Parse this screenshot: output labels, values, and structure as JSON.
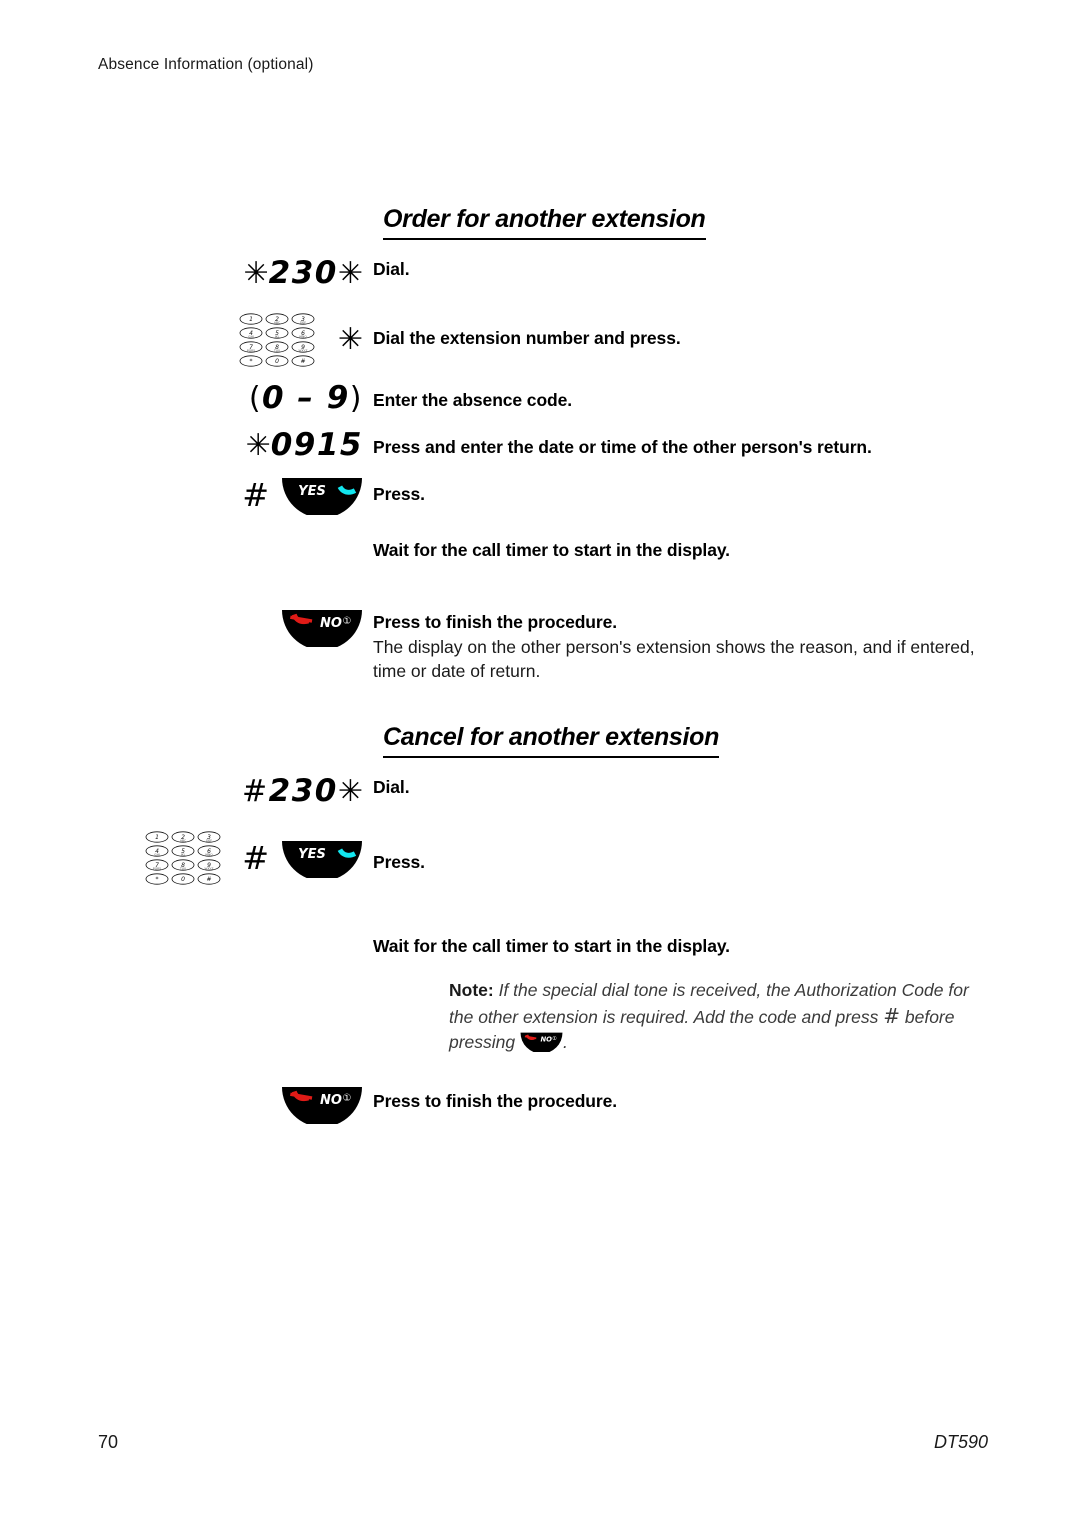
{
  "header": {
    "running_head": "Absence Information (optional)"
  },
  "sections": [
    {
      "heading": "Order for another extension",
      "steps": [
        {
          "code": "✳230✳",
          "desc": "Dial."
        },
        {
          "code": "keypad + ✳",
          "desc": "Dial the extension number and press."
        },
        {
          "code": "(0 – 9)",
          "desc": "Enter the absence code."
        },
        {
          "code": "✳0915",
          "desc": "Press and enter the date or time of the other person's return."
        },
        {
          "code": "# YES",
          "desc": "Press."
        },
        {
          "code": "",
          "desc": "Wait for the call timer to start in the display."
        },
        {
          "code": "NO",
          "desc": "Press to finish the procedure.",
          "detail": "The display on the other person's extension shows the reason, and if entered, time or date of return."
        }
      ]
    },
    {
      "heading": "Cancel for another extension",
      "steps": [
        {
          "code": "#230✳",
          "desc": "Dial."
        },
        {
          "code": "keypad # YES",
          "desc": "Press."
        },
        {
          "code": "",
          "desc": "Wait for the call timer to start in the display."
        },
        {
          "code": "NO",
          "desc": "Press to finish the procedure."
        }
      ]
    }
  ],
  "codes": {
    "order_dial_digits": "230",
    "order_absence_range": "0 – 9",
    "order_time_code_digits": "0915",
    "cancel_dial_digits": "230",
    "star_glyph": "✳",
    "hash_glyph": "#",
    "paren_open": "(",
    "paren_close": ")"
  },
  "labels": {
    "heading_order": "Order for another extension",
    "heading_cancel": "Cancel for another extension",
    "dial": "Dial.",
    "dial_ext_press": "Dial the extension number and press.",
    "enter_absence_code": "Enter the absence code.",
    "press_enter_date": "Press and enter the date or time of the other person's return.",
    "press": "Press.",
    "wait_call_timer": "Wait for the call timer to start in the display.",
    "press_finish": "Press to finish the procedure.",
    "display_detail": "The display on the other person's extension shows the reason, and if entered, time or date of return."
  },
  "note": {
    "label": "Note:",
    "text_part1": "If the special dial tone is received, the Authorization Code for the other extension is required. Add the code and press",
    "hash": "#",
    "text_part2": "before pressing",
    "text_part3": "."
  },
  "softkeys": {
    "yes_label": "YES",
    "no_label": "NO",
    "no_badge": "①"
  },
  "keypad": {
    "keys": [
      "1",
      "2",
      "3",
      "4",
      "5",
      "6",
      "7",
      "8",
      "9",
      "∗",
      "0",
      "#"
    ]
  },
  "footer": {
    "page_number": "70",
    "model": "DT590"
  },
  "colors": {
    "text": "#000000",
    "yes_handset": "#12e6ef",
    "no_handset": "#e01b17",
    "softkey_body": "#000000",
    "note_text": "#3b3b3b"
  }
}
